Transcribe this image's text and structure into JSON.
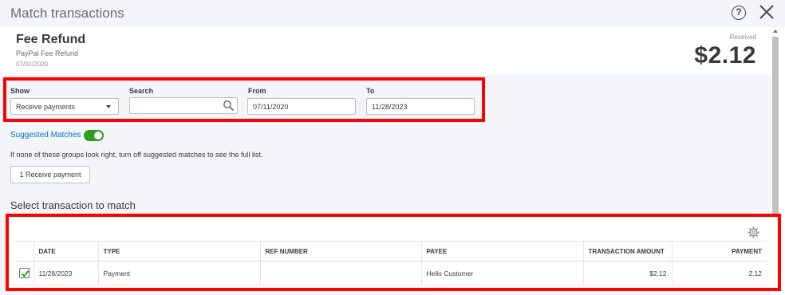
{
  "dialog": {
    "title": "Match transactions"
  },
  "transaction": {
    "name": "Fee Refund",
    "description": "PayPal Fee Refund",
    "date": "07/01/2020",
    "received_label": "Received",
    "received_amount": "$2.12"
  },
  "filters": {
    "show_label": "Show",
    "show_value": "Receive payments",
    "search_label": "Search",
    "search_value": "",
    "from_label": "From",
    "from_value": "07/11/2020",
    "to_label": "To",
    "to_value": "11/28/2023"
  },
  "suggested": {
    "label": "Suggested Matches",
    "enabled": true,
    "hint": "If none of these groups look right, turn off suggested matches to see the full list.",
    "group_button": "1 Receive payment"
  },
  "match_section": {
    "title": "Select transaction to match",
    "columns": [
      "DATE",
      "TYPE",
      "REF NUMBER",
      "PAYEE",
      "TRANSACTION AMOUNT",
      "PAYMENT"
    ],
    "rows": [
      {
        "checked": true,
        "date": "11/28/2023",
        "type": "Payment",
        "ref_number": "",
        "payee": "Hello Customer",
        "transaction_amount": "$2.12",
        "payment": "2.12"
      }
    ]
  },
  "icons": {
    "help": "help-circle-icon",
    "close": "close-icon",
    "search": "search-icon",
    "settings": "gear-icon",
    "dropdown": "caret-down-icon",
    "check": "check-icon"
  },
  "colors": {
    "accent_link": "#0077c5",
    "toggle_on": "#2ca01c",
    "highlight_border": "#ff0000",
    "check": "#2ca01c"
  }
}
